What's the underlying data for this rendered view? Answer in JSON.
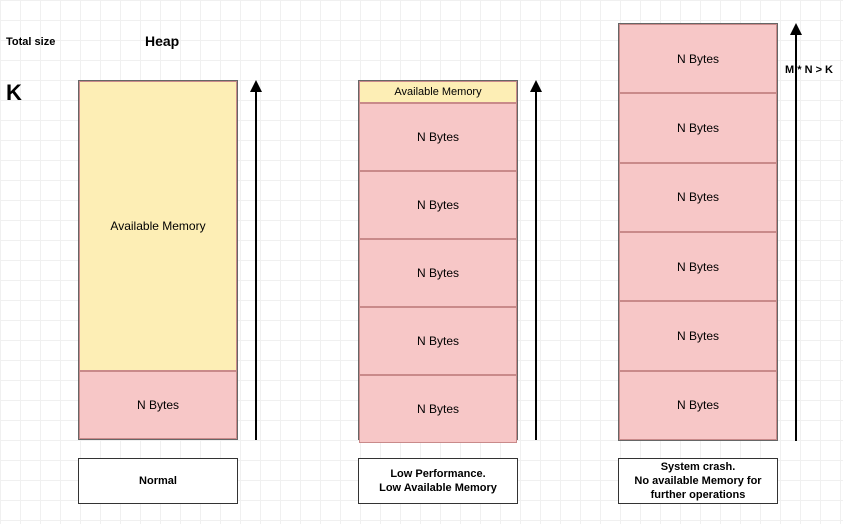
{
  "labels": {
    "total_size": "Total size",
    "heap": "Heap",
    "k": "K",
    "formula": "M * N > K",
    "available_memory": "Available Memory",
    "n_bytes": "N Bytes"
  },
  "captions": {
    "stage1": "Normal",
    "stage2": "Low Performance.\nLow Available Memory",
    "stage3": "System crash.\nNo available Memory for\nfurther operations"
  },
  "colors": {
    "available": "#fdeeb5",
    "used": "#f7c7c7",
    "border": "#c98a8a"
  },
  "chart_data": {
    "type": "bar",
    "description": "Three heap-memory columns showing progressive consumption of total size K by blocks of N bytes each.",
    "total_size_symbol": "K",
    "block_size_symbol": "N",
    "overflow_condition": "M * N > K",
    "columns": [
      {
        "name": "Normal",
        "n_blocks": 1,
        "available_remaining": "most of K",
        "overflow": false
      },
      {
        "name": "Low Performance. Low Available Memory",
        "n_blocks": 5,
        "available_remaining": "small sliver",
        "overflow": false
      },
      {
        "name": "System crash. No available Memory for further operations",
        "n_blocks": 6,
        "available_remaining": "none",
        "overflow": true
      }
    ]
  }
}
